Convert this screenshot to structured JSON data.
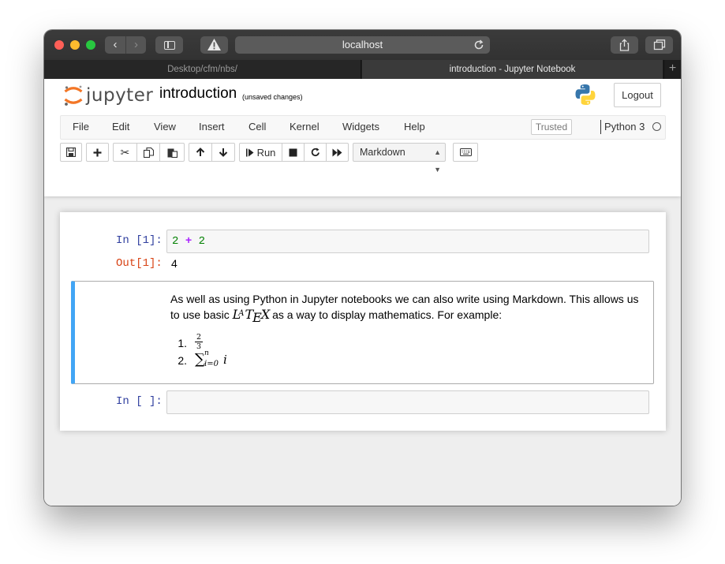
{
  "browser": {
    "url": "localhost",
    "tabs": [
      {
        "label": "Desktop/cfm/nbs/",
        "active": false
      },
      {
        "label": "introduction - Jupyter Notebook",
        "active": true
      }
    ],
    "traffic_light_colors": {
      "close": "#fe5f57",
      "minimize": "#febc2e",
      "zoom": "#28c840"
    }
  },
  "header": {
    "logo_text": "jupyter",
    "notebook_title": "introduction",
    "autosave_status": "(unsaved changes)",
    "logout_label": "Logout"
  },
  "menubar": {
    "items": [
      "File",
      "Edit",
      "View",
      "Insert",
      "Cell",
      "Kernel",
      "Widgets",
      "Help"
    ],
    "trusted_label": "Trusted",
    "kernel_name": "Python 3",
    "kernel_status": "idle"
  },
  "toolbar": {
    "run_label": "Run",
    "cell_type": "Markdown",
    "icons": [
      "save-icon",
      "plus-icon",
      "cut-icon",
      "copy-icon",
      "paste-icon",
      "arrow-up-icon",
      "arrow-down-icon",
      "run-icon",
      "stop-icon",
      "restart-icon",
      "fast-forward-icon",
      "keyboard-icon"
    ]
  },
  "cells": {
    "code1": {
      "prompt": "In [1]:",
      "code_left": "2",
      "code_op": "+",
      "code_right": "2",
      "out_prompt": "Out[1]:",
      "output": "4"
    },
    "markdown": {
      "text_before": "As well as using Python in Jupyter notebooks we can also write using Markdown. This allows us to use basic",
      "latex_logo": "LaTeX",
      "text_after": "as a way to display mathematics. For example:",
      "list": [
        {
          "num": "1.",
          "frac_num": "2",
          "frac_den": "3"
        },
        {
          "num": "2.",
          "sum_sup": "n",
          "sum_sub": "i=0",
          "sum_var": "i"
        }
      ],
      "accent_color": "#42a5f5"
    },
    "empty": {
      "prompt": "In [ ]:"
    }
  }
}
